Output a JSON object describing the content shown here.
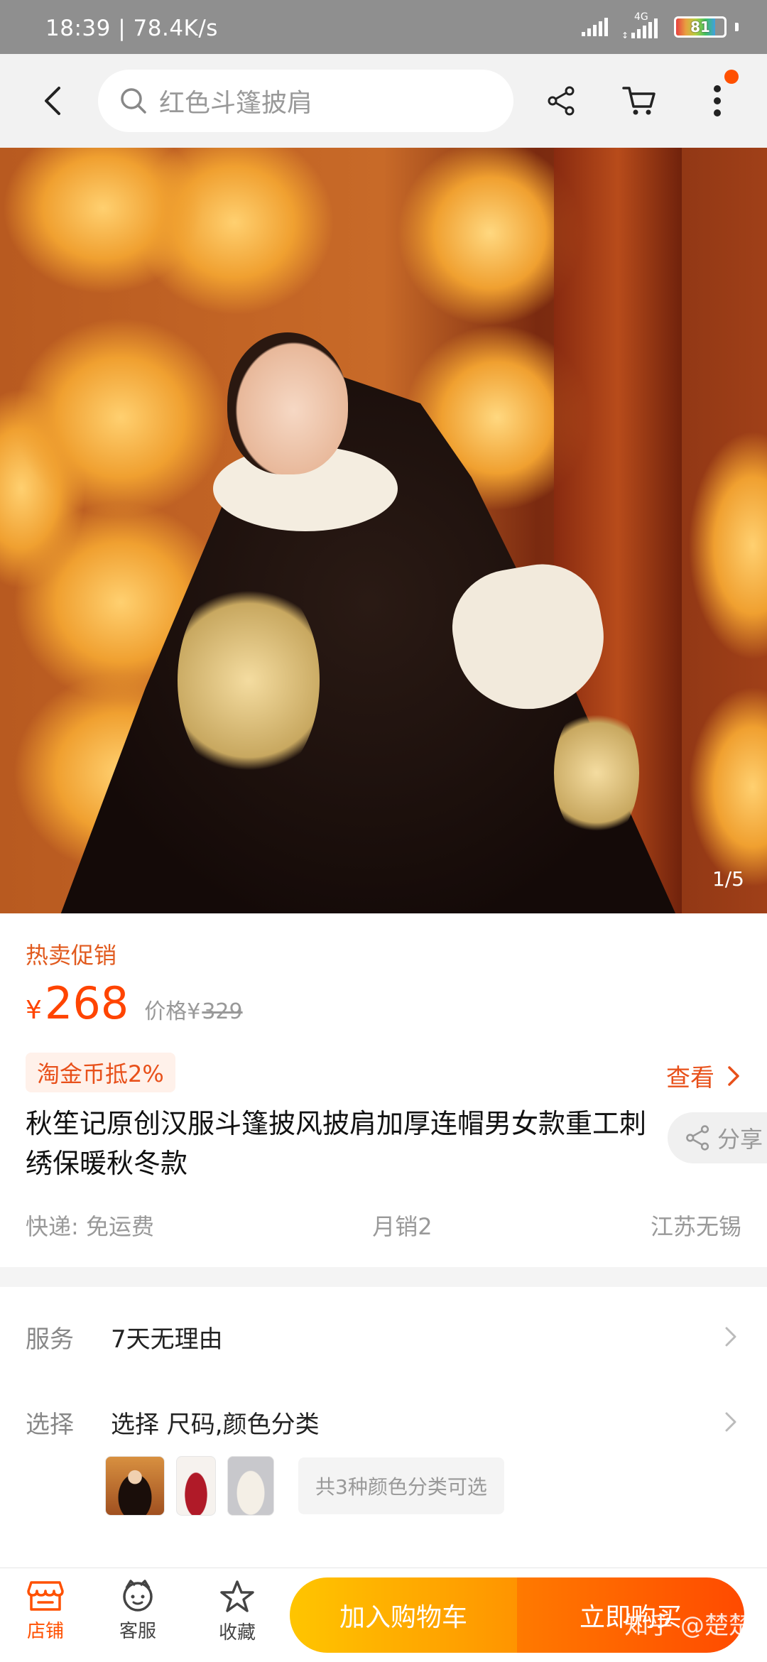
{
  "status_bar": {
    "time": "18:39",
    "net_speed": "78.4K/s",
    "network_type": "4G",
    "battery": "81",
    "battery_level": 0.81
  },
  "top_nav": {
    "search_placeholder": "红色斗篷披肩",
    "icons": [
      "back-icon",
      "search-icon",
      "share-icon",
      "cart-icon",
      "more-icon"
    ]
  },
  "hero": {
    "page_indicator": "1/5"
  },
  "product": {
    "promo_tag": "热卖促销",
    "currency": "¥",
    "price": "268",
    "orig_price_label": "价格¥",
    "orig_price": "329",
    "coin_badge": "淘金币抵2%",
    "view_label": "查看",
    "title": "秋笙记原创汉服斗篷披风披肩加厚连帽男女款重工刺绣保暖秋冬款",
    "share_label": "分享",
    "shipping": "快递: 免运费",
    "monthly_sales": "月销2",
    "location": "江苏无锡"
  },
  "services": {
    "service_label": "服务",
    "service_value": "7天无理由",
    "select_label": "选择",
    "select_value": "选择 尺码,颜色分类",
    "color_count": "共3种颜色分类可选"
  },
  "bottom_bar": {
    "store_label": "店铺",
    "support_label": "客服",
    "favorite_label": "收藏",
    "cart_label": "加入购物车",
    "buy_label": "立即购买",
    "watermark": "知乎 @楚楚"
  },
  "colors": {
    "accent": "#ff5000",
    "price": "#ff4400",
    "cart_gradient": [
      "#ffc500",
      "#ff9400"
    ],
    "buy_gradient": [
      "#ff7a00",
      "#ff4a00"
    ]
  }
}
